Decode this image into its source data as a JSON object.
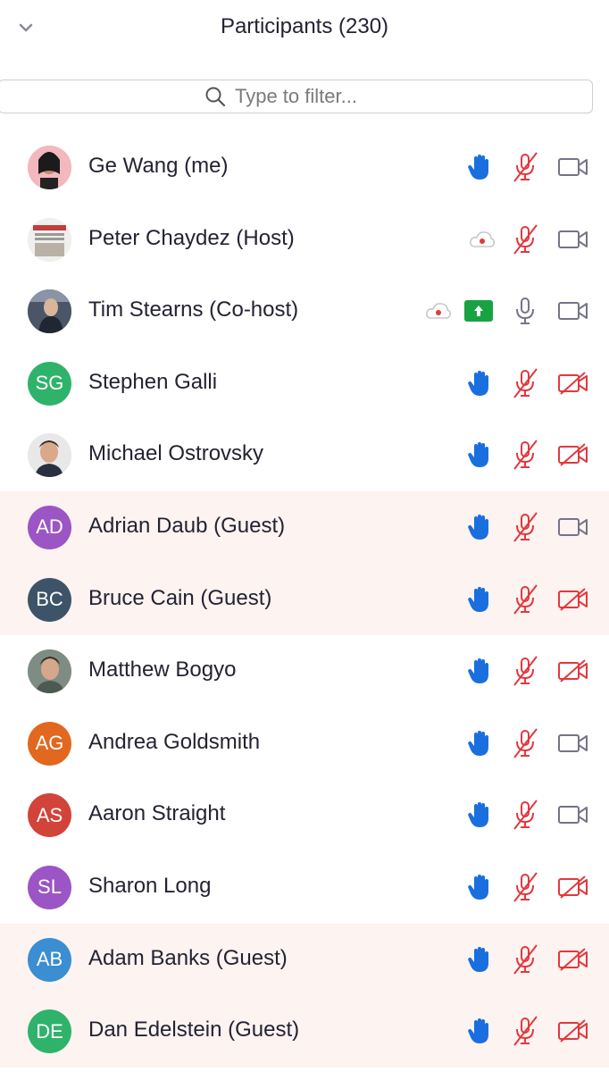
{
  "panel": {
    "title": "Participants (230)",
    "collapse_icon": "chevron-down-icon"
  },
  "search": {
    "placeholder": "Type to filter...",
    "value": ""
  },
  "colors": {
    "raise_hand": "#1a6fdf",
    "muted_red": "#e0393e",
    "camera_gray": "#747487",
    "guest_row_bg": "#fdf3f1",
    "share_green": "#17a342"
  },
  "participants": [
    {
      "name": "Ge Wang (me)",
      "avatar": "photo",
      "icons": [
        "raise-hand-icon",
        "mic-muted-icon",
        "camera-on-icon"
      ]
    },
    {
      "name": "Peter Chaydez (Host)",
      "avatar": "photo",
      "icons": [
        "cloud-recording-icon",
        "mic-muted-icon",
        "camera-on-icon"
      ]
    },
    {
      "name": "Tim Stearns (Co-host)",
      "avatar": "photo",
      "icons": [
        "cloud-recording-icon",
        "screen-share-icon",
        "mic-on-icon",
        "camera-on-icon"
      ]
    },
    {
      "name": "Stephen Galli",
      "initials": "SG",
      "avatar_color": "#2fb36b",
      "icons": [
        "raise-hand-icon",
        "mic-muted-icon",
        "camera-off-icon"
      ]
    },
    {
      "name": "Michael Ostrovsky",
      "avatar": "photo",
      "icons": [
        "raise-hand-icon",
        "mic-muted-icon",
        "camera-off-icon"
      ]
    },
    {
      "name": "Adrian Daub (Guest)",
      "initials": "AD",
      "avatar_color": "#9c55c4",
      "guest": true,
      "icons": [
        "raise-hand-icon",
        "mic-muted-icon",
        "camera-on-icon"
      ]
    },
    {
      "name": "Bruce Cain (Guest)",
      "initials": "BC",
      "avatar_color": "#3d5468",
      "guest": true,
      "icons": [
        "raise-hand-icon",
        "mic-muted-icon",
        "camera-off-icon"
      ]
    },
    {
      "name": "Matthew Bogyo",
      "avatar": "photo",
      "icons": [
        "raise-hand-icon",
        "mic-muted-icon",
        "camera-off-icon"
      ]
    },
    {
      "name": "Andrea Goldsmith",
      "initials": "AG",
      "avatar_color": "#e2671f",
      "icons": [
        "raise-hand-icon",
        "mic-muted-icon",
        "camera-on-icon"
      ]
    },
    {
      "name": "Aaron Straight",
      "initials": "AS",
      "avatar_color": "#d2433a",
      "icons": [
        "raise-hand-icon",
        "mic-muted-icon",
        "camera-on-icon"
      ]
    },
    {
      "name": "Sharon Long",
      "initials": "SL",
      "avatar_color": "#9c55c4",
      "icons": [
        "raise-hand-icon",
        "mic-muted-icon",
        "camera-off-icon"
      ]
    },
    {
      "name": "Adam Banks (Guest)",
      "initials": "AB",
      "avatar_color": "#3a8ed1",
      "guest": true,
      "icons": [
        "raise-hand-icon",
        "mic-muted-icon",
        "camera-off-icon"
      ]
    },
    {
      "name": "Dan Edelstein (Guest)",
      "initials": "DE",
      "avatar_color": "#2fb36b",
      "guest": true,
      "icons": [
        "raise-hand-icon",
        "mic-muted-icon",
        "camera-off-icon"
      ]
    }
  ]
}
